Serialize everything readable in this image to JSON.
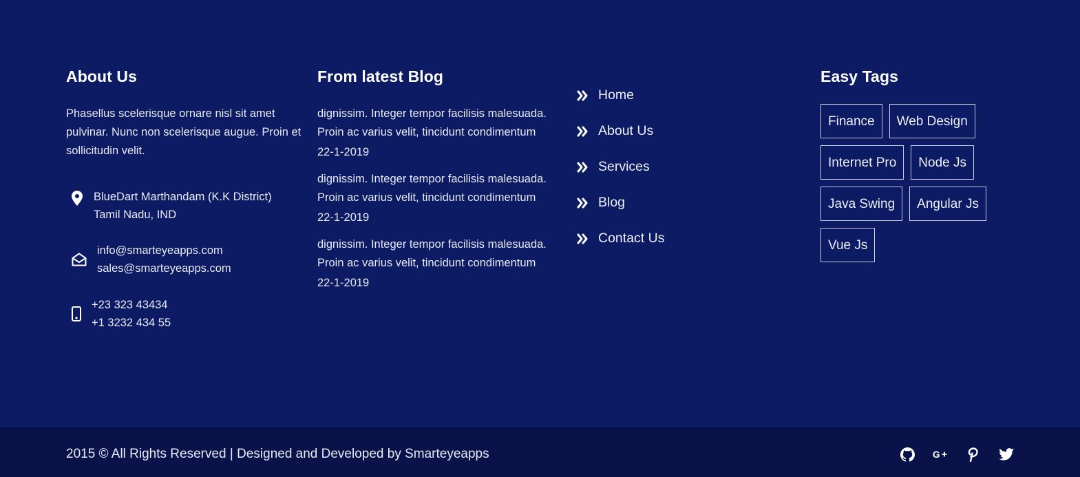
{
  "about": {
    "heading": "About Us",
    "text": "Phasellus scelerisque ornare nisl sit amet pulvinar. Nunc non scelerisque augue. Proin et sollicitudin velit.",
    "address": [
      "BlueDart Marthandam (K.K District)",
      "Tamil Nadu, IND"
    ],
    "emails": [
      "info@smarteyeapps.com",
      "sales@smarteyeapps.com"
    ],
    "phones": [
      "+23 323 43434",
      "+1 3232 434 55"
    ],
    "icons": {
      "address": "map-marker-icon",
      "email": "envelope-open-icon",
      "phone": "mobile-phone-icon"
    }
  },
  "blog": {
    "heading": "From latest Blog",
    "posts": [
      {
        "text": "dignissim. Integer tempor facilisis malesuada. Proin ac varius velit, tincidunt condimentum",
        "date": "22-1-2019"
      },
      {
        "text": "dignissim. Integer tempor facilisis malesuada. Proin ac varius velit, tincidunt condimentum",
        "date": "22-1-2019"
      },
      {
        "text": "dignissim. Integer tempor facilisis malesuada. Proin ac varius velit, tincidunt condimentum",
        "date": "22-1-2019"
      }
    ]
  },
  "links": {
    "items": [
      "Home",
      "About Us",
      "Services",
      "Blog",
      "Contact Us"
    ],
    "icon": "double-chevron-right-icon"
  },
  "tags": {
    "heading": "Easy Tags",
    "items": [
      "Finance",
      "Web Design",
      "Internet Pro",
      "Node Js",
      "Java Swing",
      "Angular Js",
      "Vue Js"
    ]
  },
  "bottom": {
    "copyright": "2015 © All Rights Reserved | Designed and Developed by Smarteyeapps",
    "social": [
      "github-icon",
      "google-plus-icon",
      "pinterest-icon",
      "twitter-icon"
    ]
  },
  "colors": {
    "main_bg": "#0c1b63",
    "bottom_bg": "#09134a",
    "text": "#e8ebf6"
  }
}
